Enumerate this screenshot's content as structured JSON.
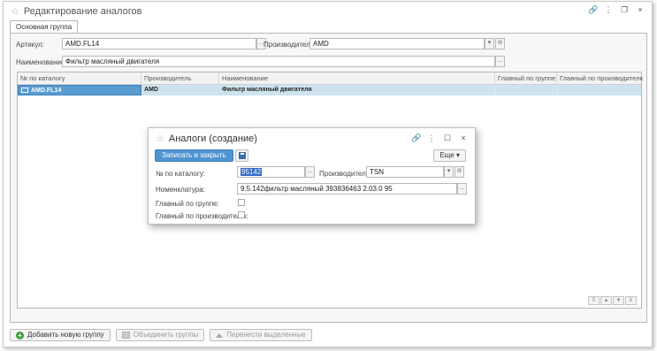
{
  "window": {
    "title": "Редактирование аналогов",
    "controls": {
      "link": "🔗",
      "more": "⋮",
      "restore": "❐",
      "close": "×"
    }
  },
  "tabs": [
    {
      "label": "Основная группа"
    }
  ],
  "form": {
    "article_label": "Артикул:",
    "article_value": "AMD.FL14",
    "manufacturer_label": "Производитель:",
    "manufacturer_value": "AMD",
    "name_label": "Наименование:",
    "name_value": "Фильтр масляный двигателя",
    "ellipsis": "...",
    "dropdown": "▾"
  },
  "grid": {
    "columns": [
      "№ по каталогу",
      "Производитель",
      "Наименование",
      "Главный по группе",
      "Главный по производителю"
    ],
    "rows": [
      {
        "catalog_no": "AMD.FL14",
        "manufacturer": "AMD",
        "name": "Фильтр масляный двигателя",
        "main_group": "",
        "main_manufacturer": ""
      }
    ],
    "scroll": [
      "⊼",
      "▲",
      "▼",
      "⊻"
    ]
  },
  "bottom_bar": {
    "add_group": "Добавить новую группу",
    "merge_groups": "Объединить группы",
    "move_selected": "Перенести выделенные"
  },
  "modal": {
    "title": "Аналоги (создание)",
    "save_close": "Записать и закрыть",
    "more": "Еще",
    "catalog_label": "№ по каталогу:",
    "catalog_value": "95142",
    "manufacturer_label": "Производитель:",
    "manufacturer_value": "TSN",
    "nomenclature_label": "Номенклатура:",
    "nomenclature_value": "9.5.142фильтр масляный 393836463 2.03.0 95",
    "main_group_label": "Главный по группе:",
    "main_manufacturer_label": "Главный по производителю:",
    "main_group_checked": false,
    "main_manufacturer_checked": false
  },
  "colors": {
    "accent": "#4f95d0",
    "selected_row": "#cfe3ef",
    "active_cell": "#5a9bd0",
    "add_icon": "#3fa03f"
  },
  "icons": [
    "star-icon",
    "link-icon",
    "more-icon",
    "restore-icon",
    "close-icon",
    "save-icon",
    "plus-icon",
    "dropdown-icon"
  ]
}
